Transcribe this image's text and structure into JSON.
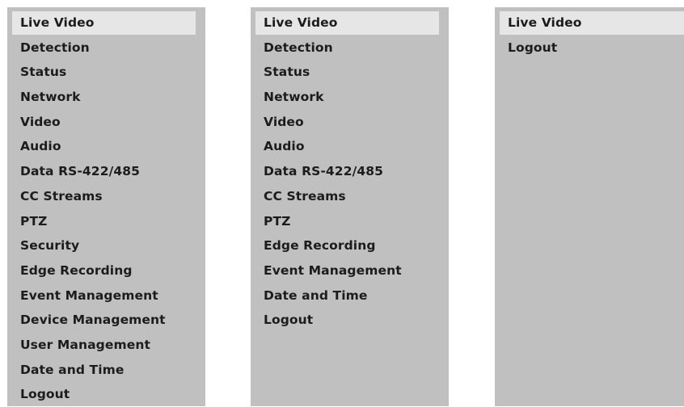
{
  "menus": [
    {
      "active_index": 0,
      "items": [
        {
          "label": "Live Video"
        },
        {
          "label": "Detection"
        },
        {
          "label": "Status"
        },
        {
          "label": "Network"
        },
        {
          "label": "Video"
        },
        {
          "label": "Audio"
        },
        {
          "label": "Data RS-422/485"
        },
        {
          "label": "CC Streams"
        },
        {
          "label": "PTZ"
        },
        {
          "label": "Security"
        },
        {
          "label": "Edge Recording"
        },
        {
          "label": "Event Management"
        },
        {
          "label": "Device Management"
        },
        {
          "label": "User Management"
        },
        {
          "label": "Date and Time"
        },
        {
          "label": "Logout"
        }
      ]
    },
    {
      "active_index": 0,
      "items": [
        {
          "label": "Live Video"
        },
        {
          "label": "Detection"
        },
        {
          "label": "Status"
        },
        {
          "label": "Network"
        },
        {
          "label": "Video"
        },
        {
          "label": "Audio"
        },
        {
          "label": "Data RS-422/485"
        },
        {
          "label": "CC Streams"
        },
        {
          "label": "PTZ"
        },
        {
          "label": "Edge Recording"
        },
        {
          "label": "Event Management"
        },
        {
          "label": "Date and Time"
        },
        {
          "label": "Logout"
        }
      ]
    },
    {
      "active_index": 0,
      "items": [
        {
          "label": "Live Video"
        },
        {
          "label": "Logout"
        }
      ]
    }
  ],
  "colors": {
    "panel_background": "#c0c0c0",
    "active_item_background": "#e6e6e6",
    "text": "#1c1c1c"
  }
}
